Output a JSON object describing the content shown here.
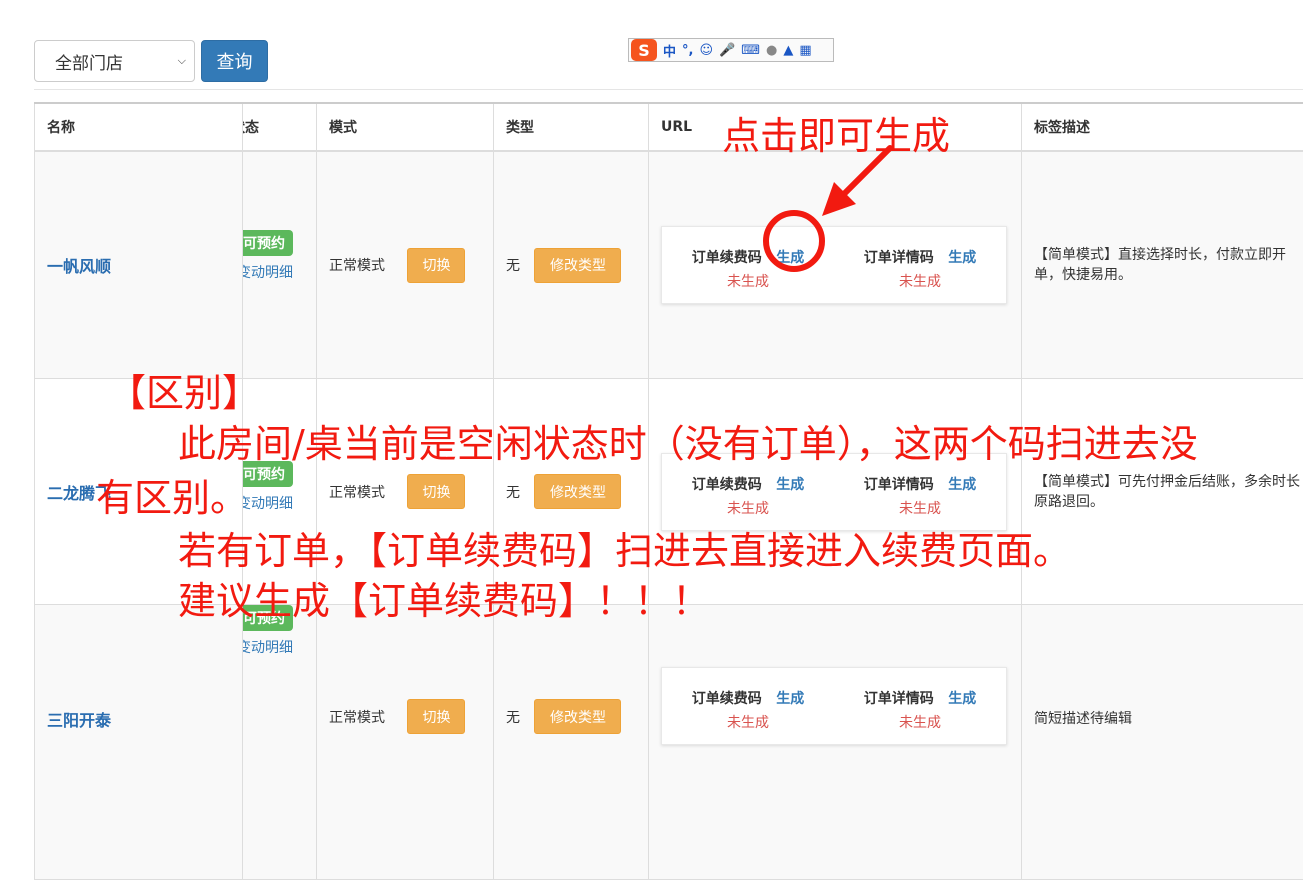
{
  "toolbar": {
    "store_select": "全部门店",
    "query_button": "查询"
  },
  "ime": {
    "label": "中",
    "punct": "°,"
  },
  "table": {
    "headers": [
      "名称",
      "状态",
      "模式",
      "类型",
      "URL",
      "标签描述"
    ],
    "rows": [
      {
        "name": "一帆风顺",
        "status_badge": "可预约",
        "detail_link": "变动明细",
        "mode": "正常模式",
        "switch_label": "切换",
        "type": "无",
        "type_button": "修改类型",
        "renew_title": "订单续费码",
        "renew_gen": "生成",
        "renew_state": "未生成",
        "detail_title": "订单详情码",
        "detail_gen": "生成",
        "detail_state": "未生成",
        "description": "【简单模式】直接选择时长，付款立即开单，快捷易用。"
      },
      {
        "name": "二龙腾飞",
        "status_badge": "可预约",
        "detail_link": "变动明细",
        "mode": "正常模式",
        "switch_label": "切换",
        "type": "无",
        "type_button": "修改类型",
        "renew_title": "订单续费码",
        "renew_gen": "生成",
        "renew_state": "未生成",
        "detail_title": "订单详情码",
        "detail_gen": "生成",
        "detail_state": "未生成",
        "description": "【简单模式】可先付押金后结账，多余时长原路退回。"
      },
      {
        "name": "三阳开泰",
        "status_badge": "可预约",
        "detail_link": "变动明细",
        "mode": "正常模式",
        "switch_label": "切换",
        "type": "无",
        "type_button": "修改类型",
        "renew_title": "订单续费码",
        "renew_gen": "生成",
        "renew_state": "未生成",
        "detail_title": "订单详情码",
        "detail_gen": "生成",
        "detail_state": "未生成",
        "description": "简短描述待编辑"
      }
    ]
  },
  "annotations": {
    "top": "点击即可生成",
    "line1": "【区别】",
    "line2": "此房间/桌当前是空闲状态时（没有订单），这两个码扫进去没",
    "line3": "有区别。",
    "line4": "若有订单，【订单续费码】扫进去直接进入续费页面。",
    "line5": "建议生成【订单续费码】！！！"
  },
  "colors": {
    "primary": "#337ab7",
    "success": "#5cb85c",
    "warning": "#f0ad4e",
    "danger": "#d9534f",
    "annotation": "#f21a10"
  }
}
